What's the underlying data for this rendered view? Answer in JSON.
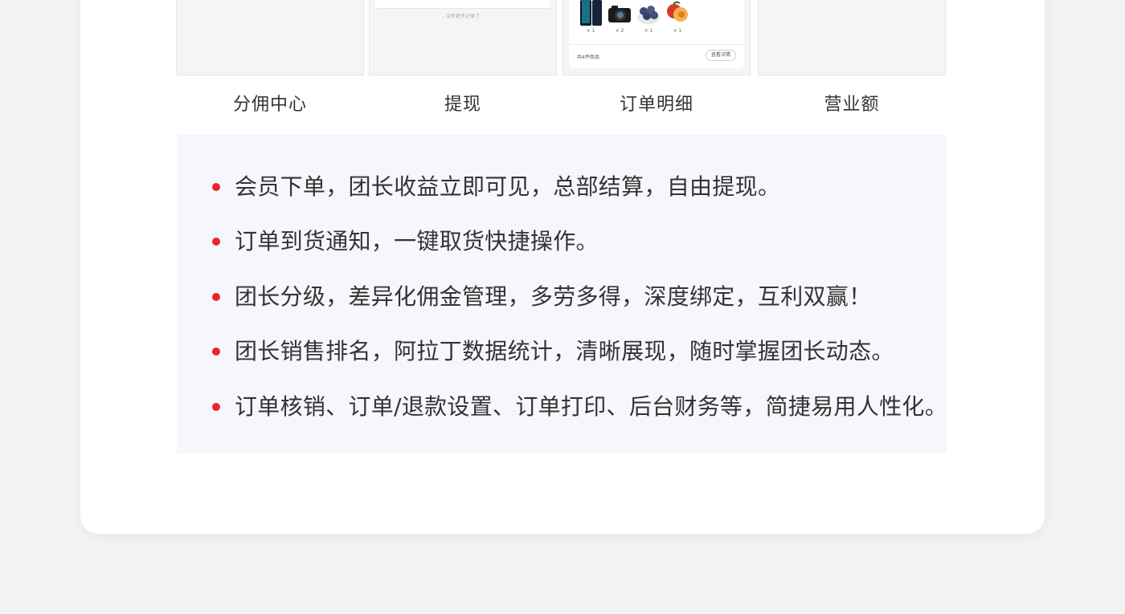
{
  "cards": [
    {
      "label": "分佣中心"
    },
    {
      "label": "提现",
      "no_more_text": "- 没有更多记录了 -"
    },
    {
      "label": "订单明细",
      "quantities": [
        "× 1",
        "× 2",
        "× 1",
        "× 1"
      ],
      "total_text": "共4件商品",
      "detail_button": "查看详情"
    },
    {
      "label": "营业额"
    }
  ],
  "features": [
    "会员下单，团长收益立即可见，总部结算，自由提现。",
    "订单到货通知，一键取货快捷操作。",
    "团长分级，差异化佣金管理，多劳多得，深度绑定，互利双赢！",
    "团长销售排名，阿拉丁数据统计，清晰展现，随时掌握团长动态。",
    "订单核销、订单/退款设置、订单打印、后台财务等，简捷易用人性化。"
  ],
  "colors": {
    "bullet": "#e8252e",
    "feature_bg": "#f6f7fc",
    "page_bg": "#f3f3f5"
  }
}
